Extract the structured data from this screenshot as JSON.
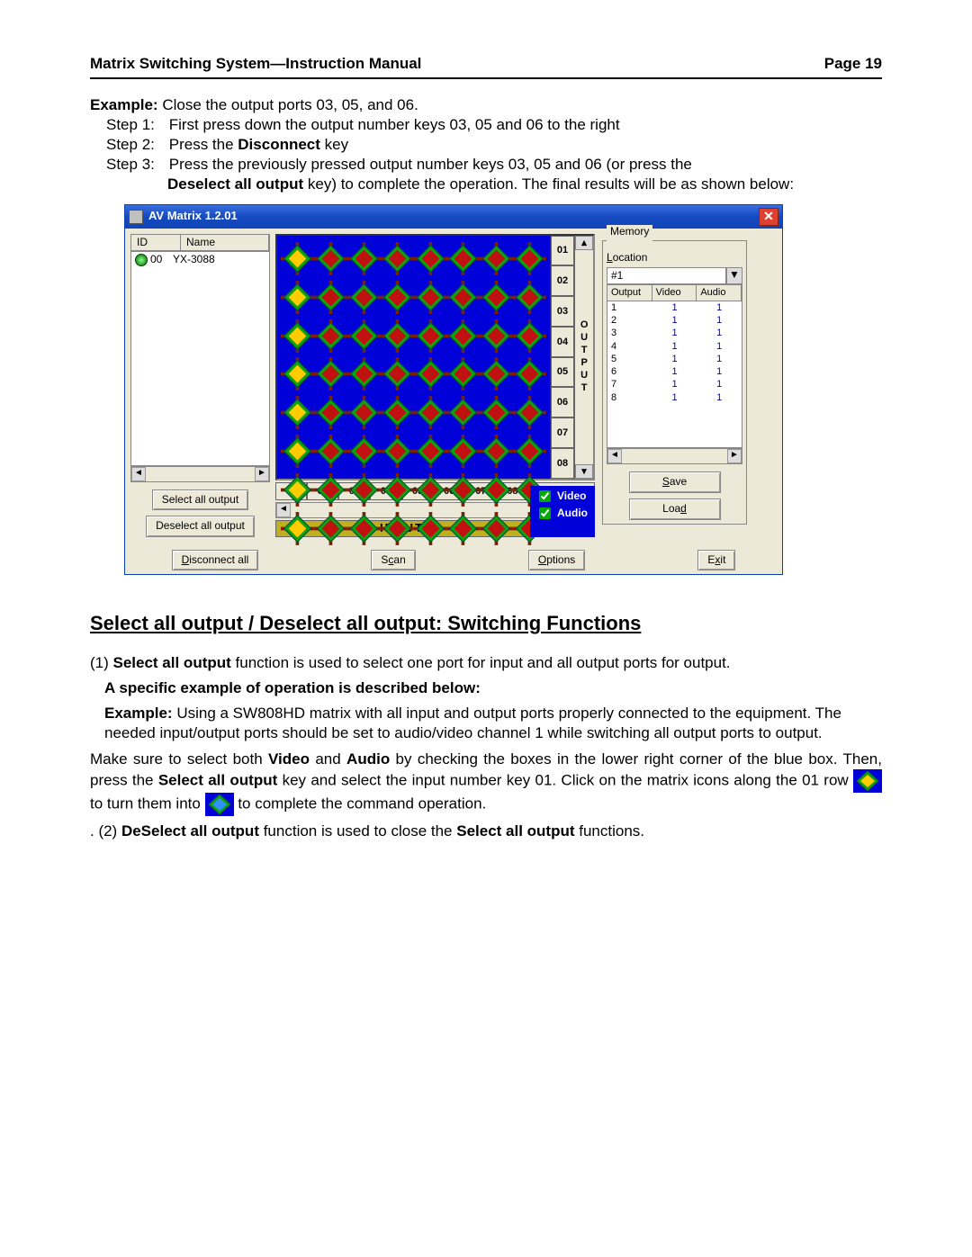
{
  "header": {
    "title": "Matrix Switching System—Instruction Manual",
    "page": "Page 19"
  },
  "example": {
    "label": "Example:",
    "text": "Close the output ports 03, 05, and 06."
  },
  "steps": [
    {
      "lbl": "Step 1:",
      "txt": "First press down the output number keys 03, 05 and 06 to the right"
    },
    {
      "lbl": "Step 2:",
      "txt": "Press the ",
      "bold": "Disconnect",
      "txt2": " key"
    },
    {
      "lbl": "Step 3:",
      "txt": "Press the previously pressed output number keys 03, 05 and 06 (or press the"
    }
  ],
  "step3b": {
    "bold": "Deselect all output",
    "txt": " key) to complete the operation. The final results will be as shown below:"
  },
  "win": {
    "title": "AV Matrix 1.2.01"
  },
  "list": {
    "h1": "ID",
    "h2": "Name",
    "id": "00",
    "name": "YX-3088"
  },
  "outputs": [
    "01",
    "02",
    "03",
    "04",
    "05",
    "06",
    "07",
    "08"
  ],
  "inputs": [
    "01",
    "02",
    "03",
    "04",
    "05",
    "06",
    "07",
    "08"
  ],
  "vlabel": "OUTPUT",
  "disconnect": "Disconnect",
  "inputlabel": "INPUT",
  "av": {
    "video": "Video",
    "audio": "Audio"
  },
  "mem": {
    "group": "Memory",
    "loc": "Location",
    "val": "#1"
  },
  "tbl": {
    "h": [
      "Output",
      "Video",
      "Audio"
    ],
    "rows": [
      [
        "1",
        "1",
        "1"
      ],
      [
        "2",
        "1",
        "1"
      ],
      [
        "3",
        "1",
        "1"
      ],
      [
        "4",
        "1",
        "1"
      ],
      [
        "5",
        "1",
        "1"
      ],
      [
        "6",
        "1",
        "1"
      ],
      [
        "7",
        "1",
        "1"
      ],
      [
        "8",
        "1",
        "1"
      ]
    ]
  },
  "btns": {
    "save": "Save",
    "load": "Load",
    "selall": "Select all output",
    "deselall": "Deselect all output",
    "discoall": "Disconnect all",
    "scan": "Scan",
    "options": "Options",
    "exit": "Exit"
  },
  "section": "Select all output / Deselect all output: Switching Functions",
  "body": {
    "p1a": "(1) ",
    "p1b": "Select all output",
    "p1c": " function is used to select one port for input and all output ports for output.",
    "p2": "A specific example of operation is described below:",
    "p3a": "Example:",
    "p3b": "  Using a SW808HD matrix with all input and output ports properly connected to the equipment. The needed input/output ports should be set to audio/video channel 1 while switching all output ports to output.",
    "p4a": "Make sure to select both ",
    "p4b": "Video",
    "p4c": " and ",
    "p4d": "Audio",
    "p4e": " by checking the boxes in the lower right corner of the blue box. Then, press the ",
    "p4f": "Select all output",
    "p4g": " key and select the input number key 01. Click on the matrix icons along the 01 row ",
    "p4h": " to turn them into ",
    "p4i": " to complete the command operation.",
    "p5a": ". (2)  ",
    "p5b": "DeSelect all output",
    "p5c": " function is used to close the ",
    "p5d": "Select all output",
    "p5e": " functions."
  }
}
